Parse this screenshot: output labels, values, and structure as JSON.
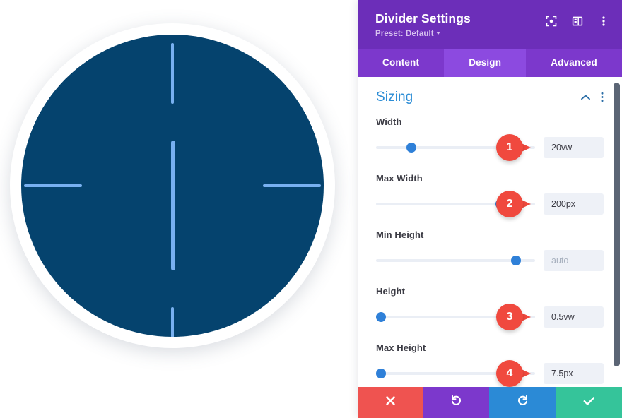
{
  "canvas": {
    "name": "divider-preview",
    "circle_fill": "#05436e",
    "ring_fill": "#ffffff",
    "divider_color": "#78b0f0",
    "dividers": [
      {
        "name": "divider-vertical-top",
        "orientation": "vertical"
      },
      {
        "name": "divider-vertical-center",
        "orientation": "vertical"
      },
      {
        "name": "divider-vertical-bottom",
        "orientation": "vertical"
      },
      {
        "name": "divider-horizontal-left",
        "orientation": "horizontal"
      },
      {
        "name": "divider-horizontal-right",
        "orientation": "horizontal"
      }
    ]
  },
  "panel": {
    "title": "Divider Settings",
    "preset_label": "Preset: Default",
    "header_color": "#6c2eb9",
    "accent_color": "#8c4ae0",
    "icons": {
      "focus": "focus-icon",
      "layout": "layout-icon",
      "more": "more-vertical-icon"
    },
    "tabs": [
      {
        "label": "Content",
        "active": false
      },
      {
        "label": "Design",
        "active": true
      },
      {
        "label": "Advanced",
        "active": false
      }
    ],
    "section": {
      "title": "Sizing",
      "title_color": "#2c8dd6",
      "collapse_icon": "chevron-up-icon",
      "options_icon": "more-vertical-icon"
    },
    "fields": [
      {
        "label": "Width",
        "value": "20vw",
        "placeholder": "",
        "slider_percent": 22,
        "badge": "1"
      },
      {
        "label": "Max Width",
        "value": "200px",
        "placeholder": "",
        "slider_percent": 78,
        "badge": "2"
      },
      {
        "label": "Min Height",
        "value": "",
        "placeholder": "auto",
        "slider_percent": 88,
        "badge": ""
      },
      {
        "label": "Height",
        "value": "0.5vw",
        "placeholder": "",
        "slider_percent": 3,
        "badge": "3"
      },
      {
        "label": "Max Height",
        "value": "7.5px",
        "placeholder": "",
        "slider_percent": 3,
        "badge": "4"
      }
    ],
    "actions": [
      {
        "name": "cancel-button",
        "icon": "close-icon",
        "color": "#ef5350"
      },
      {
        "name": "undo-button",
        "icon": "undo-icon",
        "color": "#7c38cc"
      },
      {
        "name": "redo-button",
        "icon": "redo-icon",
        "color": "#2b8ad6"
      },
      {
        "name": "save-button",
        "icon": "check-icon",
        "color": "#35c49a"
      }
    ]
  }
}
